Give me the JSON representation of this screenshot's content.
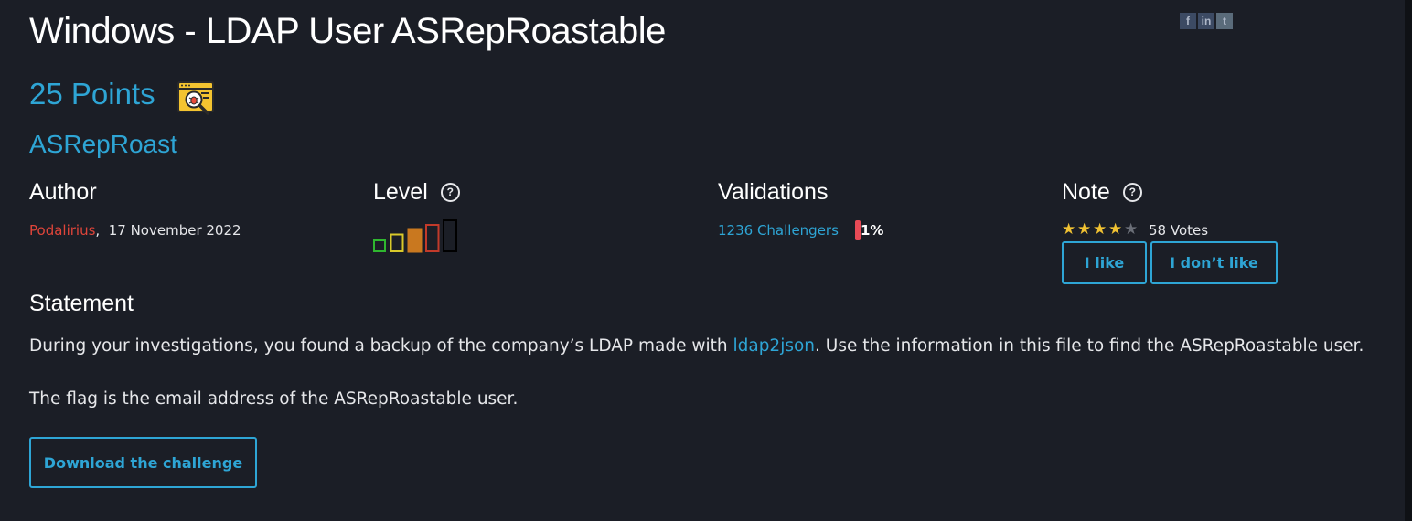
{
  "challenge": {
    "title": "Windows - LDAP User ASRepRoastable",
    "points": "25 Points",
    "category": "ASRepRoast"
  },
  "social": {
    "facebook": "f",
    "linkedin": "in",
    "twitter": "t"
  },
  "author": {
    "heading": "Author",
    "name": "Podalirius",
    "separator": ",",
    "date": "17 November 2022"
  },
  "level": {
    "heading": "Level",
    "help": "?",
    "current": 3,
    "max": 5,
    "colors": [
      "#2fb72f",
      "#d9c92a",
      "#c9781f",
      "#c23a2a",
      "#000000"
    ]
  },
  "validations": {
    "heading": "Validations",
    "challengers": "1236 Challengers",
    "percent": "1%"
  },
  "note": {
    "heading": "Note",
    "help": "?",
    "rating": 4,
    "rating_max": 5,
    "votes": "58 Votes",
    "like_label": "I like",
    "dislike_label": "I don’t like"
  },
  "statement": {
    "heading": "Statement",
    "line1_before": "During your investigations, you found a backup of the company’s LDAP made with ",
    "line1_link": "ldap2json",
    "line1_after": ". Use the information in this file to find the ASRepRoastable user.",
    "line2": "The flag is the email address of the ASRepRoastable user."
  },
  "download_label": "Download the challenge",
  "colors": {
    "accent": "#2ea5d5",
    "author_red": "#e0453a",
    "panel_bg": "#1b1e26",
    "page_bg": "#0f1115"
  }
}
